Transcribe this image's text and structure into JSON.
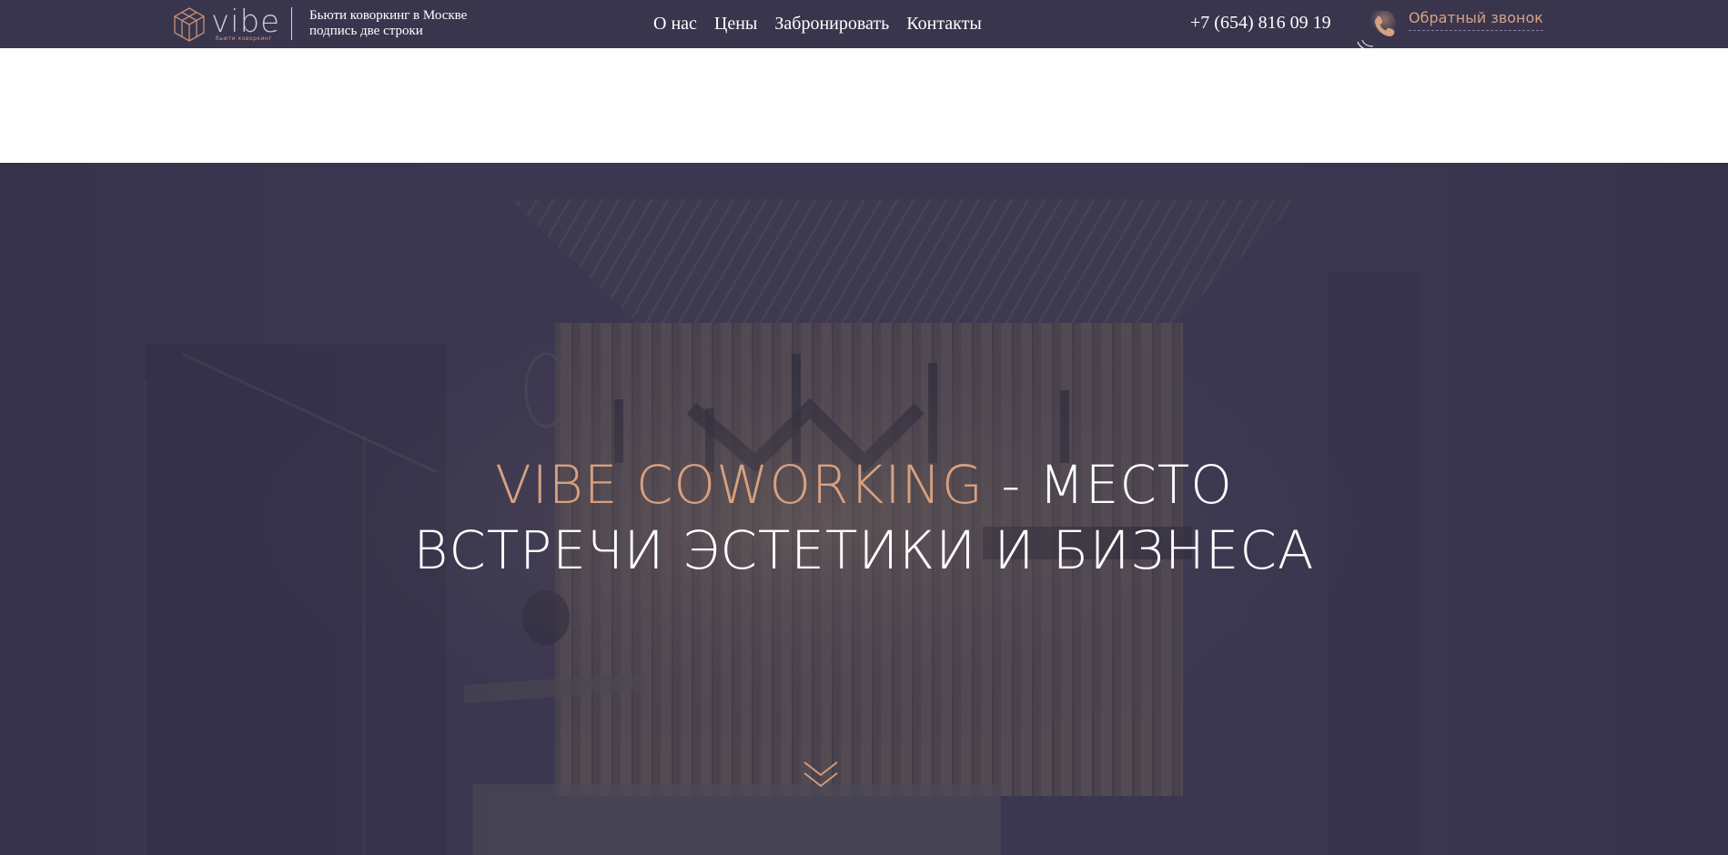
{
  "header": {
    "logo": {
      "word": "vibe",
      "subtitle": "бьюти коворкинг"
    },
    "tagline": {
      "line1": "Бьюти коворкинг в Москве",
      "line2": "подпись две строки"
    },
    "nav": [
      {
        "label": "О нас"
      },
      {
        "label": "Цены"
      },
      {
        "label": "Забронировать"
      },
      {
        "label": "Контакты"
      }
    ],
    "phone": "+7 (654) 816 09 19",
    "callback": {
      "label": "Обратный звонок",
      "icon": "phone-icon"
    }
  },
  "hero": {
    "title_accent": "VIBE COWORKING",
    "title_rest_line1": " - МЕСТО",
    "title_line2": "ВСТРЕЧИ ЭСТЕТИКИ И БИЗНЕСА",
    "scroll_icon": "chevron-double-down-icon"
  },
  "colors": {
    "header_bg": "#39354d",
    "accent": "#d9a07f",
    "hero_overlay": "#3b3750"
  }
}
